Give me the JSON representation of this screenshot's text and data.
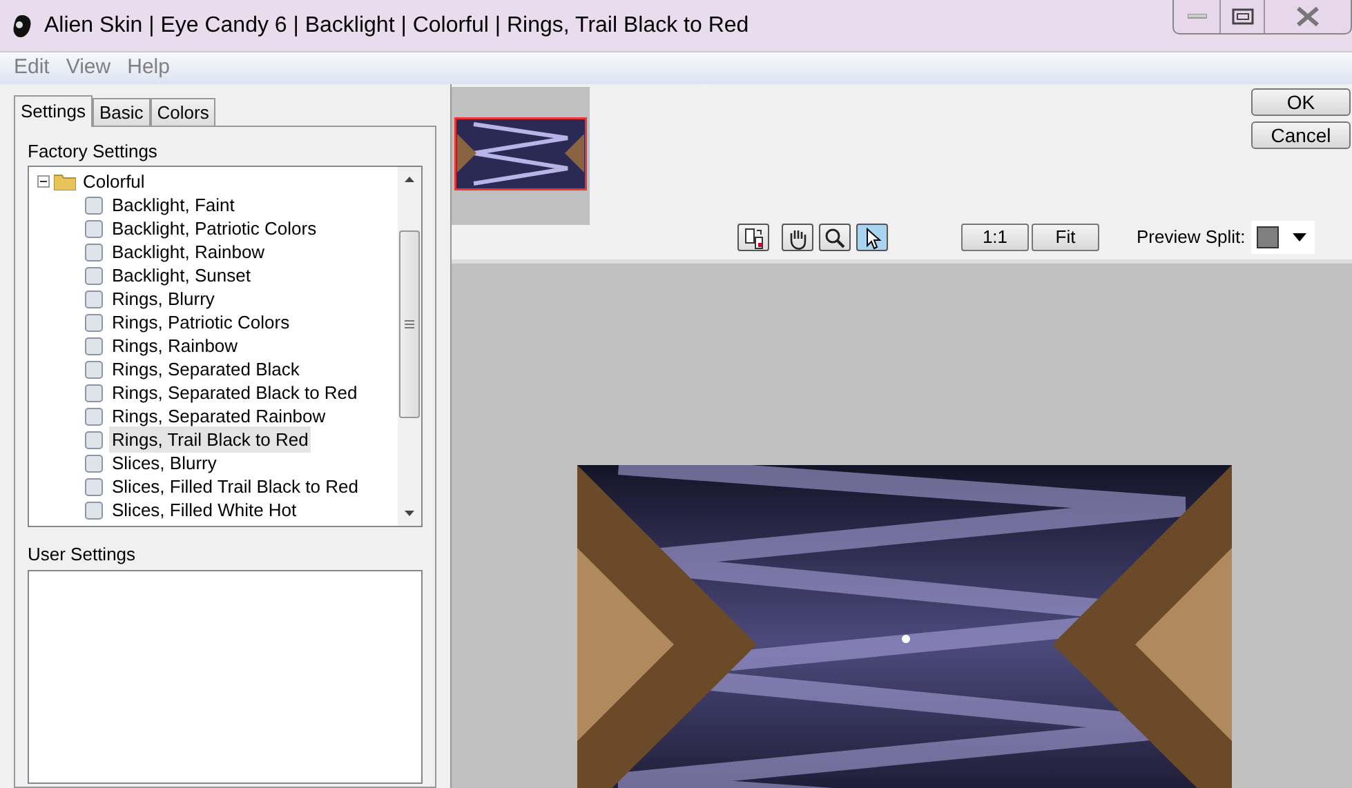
{
  "window": {
    "title": "Alien Skin | Eye Candy 6 | Backlight | Colorful | Rings, Trail Black to Red"
  },
  "menu": [
    "Edit",
    "View",
    "Help"
  ],
  "tabs": [
    {
      "label": "Settings",
      "selected": true
    },
    {
      "label": "Basic",
      "selected": false
    },
    {
      "label": "Colors",
      "selected": false
    }
  ],
  "factory_settings": {
    "label": "Factory Settings",
    "tree": [
      {
        "label": "Colorful",
        "expanded": true,
        "children": [
          {
            "label": "Backlight, Faint",
            "selected": false
          },
          {
            "label": "Backlight, Patriotic Colors",
            "selected": false
          },
          {
            "label": "Backlight, Rainbow",
            "selected": false
          },
          {
            "label": "Backlight, Sunset",
            "selected": false
          },
          {
            "label": "Rings, Blurry",
            "selected": false
          },
          {
            "label": "Rings, Patriotic Colors",
            "selected": false
          },
          {
            "label": "Rings, Rainbow",
            "selected": false
          },
          {
            "label": "Rings, Separated Black",
            "selected": false
          },
          {
            "label": "Rings, Separated Black to Red",
            "selected": false
          },
          {
            "label": "Rings, Separated Rainbow",
            "selected": false
          },
          {
            "label": "Rings, Trail Black to Red",
            "selected": true
          },
          {
            "label": "Slices, Blurry",
            "selected": false
          },
          {
            "label": "Slices, Filled Trail Black to Red",
            "selected": false
          },
          {
            "label": "Slices, Filled White Hot",
            "selected": false
          }
        ]
      }
    ]
  },
  "user_settings": {
    "label": "User Settings"
  },
  "buttons": [
    "OK",
    "Cancel"
  ],
  "tools": [
    {
      "kind": "swap",
      "selected": false
    },
    {
      "kind": "hand",
      "selected": false
    },
    {
      "kind": "zoom",
      "selected": false
    },
    {
      "kind": "pointer",
      "selected": true
    }
  ],
  "zoom_buttons": [
    "1:1",
    "Fit"
  ],
  "preview_split": {
    "label": "Preview Split:"
  }
}
